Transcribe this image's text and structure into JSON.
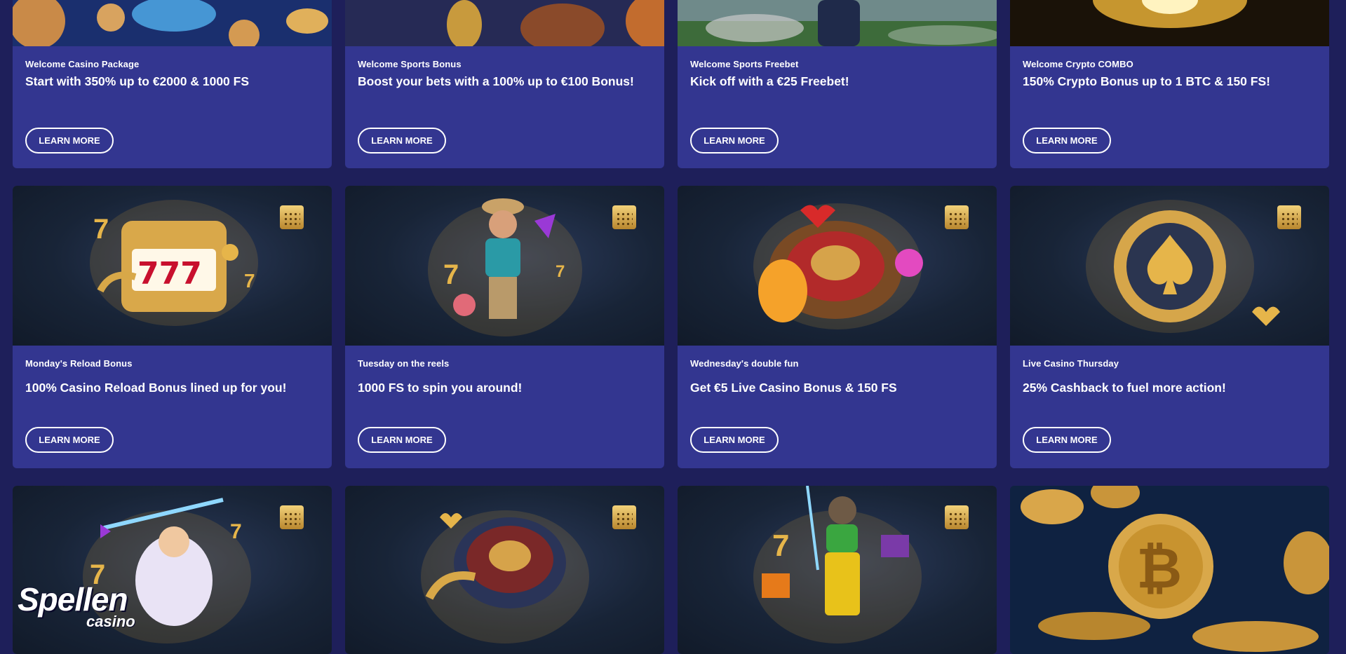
{
  "promotions": [
    {
      "subtitle": "Welcome Casino Package",
      "title": "Start with 350% up to €2000 & 1000 FS",
      "button": "LEARN MORE",
      "image": "casino-coins-lamp"
    },
    {
      "subtitle": "Welcome Sports Bonus",
      "title": "Boost your bets with a 100% up to €100 Bonus!",
      "button": "LEARN MORE",
      "image": "trophy-football"
    },
    {
      "subtitle": "Welcome Sports Freebet",
      "title": "Kick off with a €25 Freebet!",
      "button": "LEARN MORE",
      "image": "football-player"
    },
    {
      "subtitle": "Welcome Crypto COMBO",
      "title": "150% Crypto Bonus up to 1 BTC & 150 FS!",
      "button": "LEARN MORE",
      "image": "golden-circuit"
    },
    {
      "subtitle": "Monday's Reload Bonus",
      "title": "100% Casino Reload Bonus lined up for you!",
      "button": "LEARN MORE",
      "image": "slot-machine-777"
    },
    {
      "subtitle": "Tuesday on the reels",
      "title": "1000 FS to spin you around!",
      "button": "LEARN MORE",
      "image": "cowboy-character"
    },
    {
      "subtitle": "Wednesday's double fun",
      "title": "Get €5 Live Casino Bonus & 150 FS",
      "button": "LEARN MORE",
      "image": "roulette-teddy-bear"
    },
    {
      "subtitle": "Live Casino Thursday",
      "title": "25% Cashback to fuel more action!",
      "button": "LEARN MORE",
      "image": "poker-chip-spade"
    },
    {
      "image": "zeus-lightning"
    },
    {
      "image": "roulette-wheel"
    },
    {
      "image": "miner-character"
    },
    {
      "image": "bitcoin-coins"
    }
  ],
  "logo": {
    "word": "Spellen",
    "sub": "casino",
    "dot_color": "#e0182d",
    "leaf_color": "#2aa84a"
  },
  "colors": {
    "background": "#1e1f5a",
    "card": "#333690",
    "gold": "#e6b54a"
  }
}
